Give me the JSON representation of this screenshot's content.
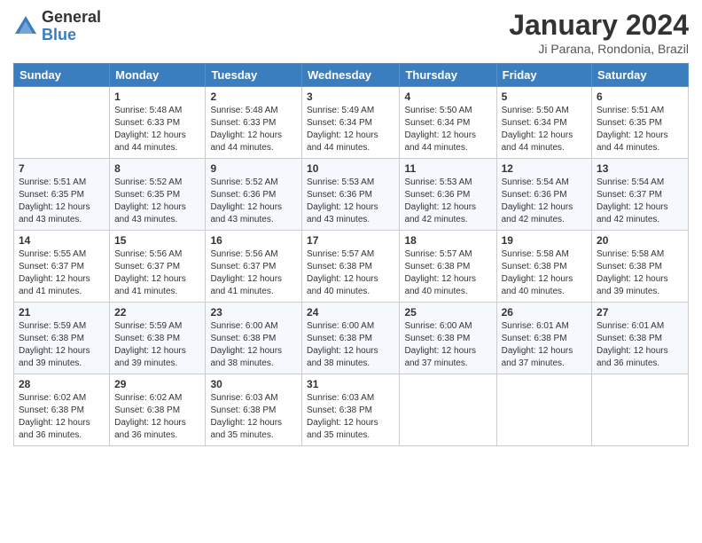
{
  "logo": {
    "general": "General",
    "blue": "Blue"
  },
  "title": {
    "month_year": "January 2024",
    "location": "Ji Parana, Rondonia, Brazil"
  },
  "headers": [
    "Sunday",
    "Monday",
    "Tuesday",
    "Wednesday",
    "Thursday",
    "Friday",
    "Saturday"
  ],
  "weeks": [
    [
      {
        "day": "",
        "info": ""
      },
      {
        "day": "1",
        "info": "Sunrise: 5:48 AM\nSunset: 6:33 PM\nDaylight: 12 hours\nand 44 minutes."
      },
      {
        "day": "2",
        "info": "Sunrise: 5:48 AM\nSunset: 6:33 PM\nDaylight: 12 hours\nand 44 minutes."
      },
      {
        "day": "3",
        "info": "Sunrise: 5:49 AM\nSunset: 6:34 PM\nDaylight: 12 hours\nand 44 minutes."
      },
      {
        "day": "4",
        "info": "Sunrise: 5:50 AM\nSunset: 6:34 PM\nDaylight: 12 hours\nand 44 minutes."
      },
      {
        "day": "5",
        "info": "Sunrise: 5:50 AM\nSunset: 6:34 PM\nDaylight: 12 hours\nand 44 minutes."
      },
      {
        "day": "6",
        "info": "Sunrise: 5:51 AM\nSunset: 6:35 PM\nDaylight: 12 hours\nand 44 minutes."
      }
    ],
    [
      {
        "day": "7",
        "info": "Sunrise: 5:51 AM\nSunset: 6:35 PM\nDaylight: 12 hours\nand 43 minutes."
      },
      {
        "day": "8",
        "info": "Sunrise: 5:52 AM\nSunset: 6:35 PM\nDaylight: 12 hours\nand 43 minutes."
      },
      {
        "day": "9",
        "info": "Sunrise: 5:52 AM\nSunset: 6:36 PM\nDaylight: 12 hours\nand 43 minutes."
      },
      {
        "day": "10",
        "info": "Sunrise: 5:53 AM\nSunset: 6:36 PM\nDaylight: 12 hours\nand 43 minutes."
      },
      {
        "day": "11",
        "info": "Sunrise: 5:53 AM\nSunset: 6:36 PM\nDaylight: 12 hours\nand 42 minutes."
      },
      {
        "day": "12",
        "info": "Sunrise: 5:54 AM\nSunset: 6:36 PM\nDaylight: 12 hours\nand 42 minutes."
      },
      {
        "day": "13",
        "info": "Sunrise: 5:54 AM\nSunset: 6:37 PM\nDaylight: 12 hours\nand 42 minutes."
      }
    ],
    [
      {
        "day": "14",
        "info": "Sunrise: 5:55 AM\nSunset: 6:37 PM\nDaylight: 12 hours\nand 41 minutes."
      },
      {
        "day": "15",
        "info": "Sunrise: 5:56 AM\nSunset: 6:37 PM\nDaylight: 12 hours\nand 41 minutes."
      },
      {
        "day": "16",
        "info": "Sunrise: 5:56 AM\nSunset: 6:37 PM\nDaylight: 12 hours\nand 41 minutes."
      },
      {
        "day": "17",
        "info": "Sunrise: 5:57 AM\nSunset: 6:38 PM\nDaylight: 12 hours\nand 40 minutes."
      },
      {
        "day": "18",
        "info": "Sunrise: 5:57 AM\nSunset: 6:38 PM\nDaylight: 12 hours\nand 40 minutes."
      },
      {
        "day": "19",
        "info": "Sunrise: 5:58 AM\nSunset: 6:38 PM\nDaylight: 12 hours\nand 40 minutes."
      },
      {
        "day": "20",
        "info": "Sunrise: 5:58 AM\nSunset: 6:38 PM\nDaylight: 12 hours\nand 39 minutes."
      }
    ],
    [
      {
        "day": "21",
        "info": "Sunrise: 5:59 AM\nSunset: 6:38 PM\nDaylight: 12 hours\nand 39 minutes."
      },
      {
        "day": "22",
        "info": "Sunrise: 5:59 AM\nSunset: 6:38 PM\nDaylight: 12 hours\nand 39 minutes."
      },
      {
        "day": "23",
        "info": "Sunrise: 6:00 AM\nSunset: 6:38 PM\nDaylight: 12 hours\nand 38 minutes."
      },
      {
        "day": "24",
        "info": "Sunrise: 6:00 AM\nSunset: 6:38 PM\nDaylight: 12 hours\nand 38 minutes."
      },
      {
        "day": "25",
        "info": "Sunrise: 6:00 AM\nSunset: 6:38 PM\nDaylight: 12 hours\nand 37 minutes."
      },
      {
        "day": "26",
        "info": "Sunrise: 6:01 AM\nSunset: 6:38 PM\nDaylight: 12 hours\nand 37 minutes."
      },
      {
        "day": "27",
        "info": "Sunrise: 6:01 AM\nSunset: 6:38 PM\nDaylight: 12 hours\nand 36 minutes."
      }
    ],
    [
      {
        "day": "28",
        "info": "Sunrise: 6:02 AM\nSunset: 6:38 PM\nDaylight: 12 hours\nand 36 minutes."
      },
      {
        "day": "29",
        "info": "Sunrise: 6:02 AM\nSunset: 6:38 PM\nDaylight: 12 hours\nand 36 minutes."
      },
      {
        "day": "30",
        "info": "Sunrise: 6:03 AM\nSunset: 6:38 PM\nDaylight: 12 hours\nand 35 minutes."
      },
      {
        "day": "31",
        "info": "Sunrise: 6:03 AM\nSunset: 6:38 PM\nDaylight: 12 hours\nand 35 minutes."
      },
      {
        "day": "",
        "info": ""
      },
      {
        "day": "",
        "info": ""
      },
      {
        "day": "",
        "info": ""
      }
    ]
  ]
}
